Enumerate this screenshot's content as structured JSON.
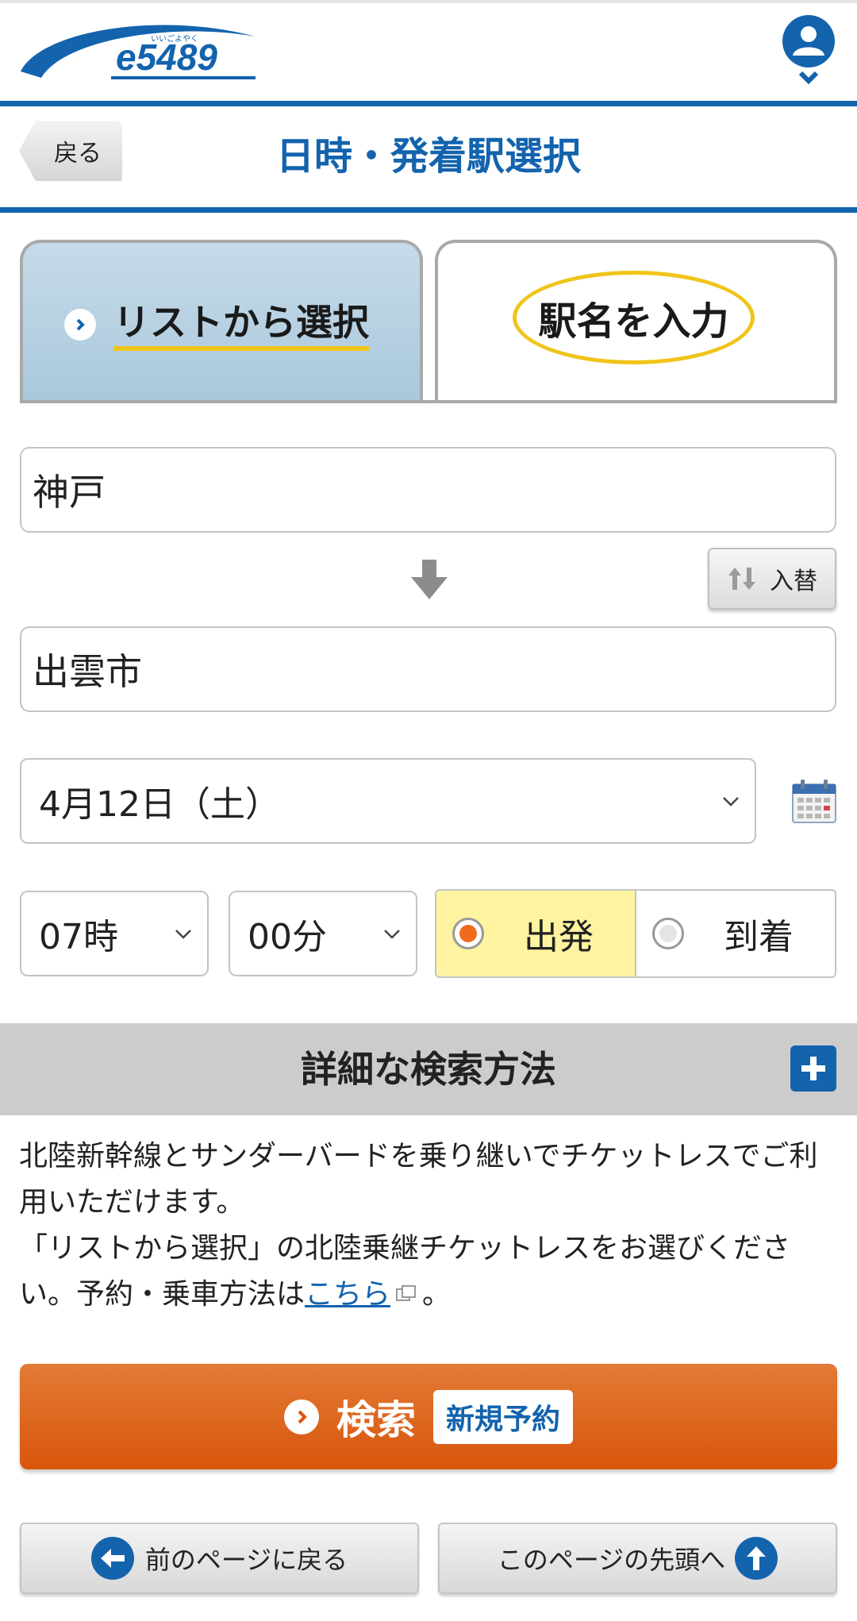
{
  "header": {
    "logo_text": "e5489",
    "logo_ruby": "いいごよやく",
    "account_icon": "person-icon"
  },
  "title_bar": {
    "back_label": "戻る",
    "title": "日時・発着駅選択"
  },
  "tabs": [
    {
      "label": "リストから選択",
      "icon": "chevron-right-icon"
    },
    {
      "label": "駅名を入力"
    }
  ],
  "form": {
    "from_station": "神戸",
    "swap_label": "入替",
    "to_station": "出雲市",
    "date": "4月12日（土）",
    "hour": "07時",
    "minute": "00分",
    "direction_options": [
      {
        "label": "出発",
        "selected": true
      },
      {
        "label": "到着",
        "selected": false
      }
    ]
  },
  "detail_search": {
    "label": "詳細な検索方法",
    "toggle_icon": "plus-icon"
  },
  "notice": {
    "line1": "北陸新幹線とサンダーバードを乗り継いでチケットレスでご利用いただけます。",
    "line2_pre": "「リストから選択」の北陸乗継チケットレスをお選びください。予約・乗車方法は",
    "link": "こちら",
    "line2_post": "。"
  },
  "search_button": {
    "label": "検索",
    "tag": "新規予約"
  },
  "footer": {
    "prev_label": "前のページに戻る",
    "top_label": "このページの先頭へ"
  },
  "colors": {
    "brand_blue": "#1363ad",
    "search_orange": "#d9560c",
    "highlight_yellow": "#f0c419",
    "selected_radio_bg": "#fdf3a0",
    "radio_selected_dot": "#f06a1e"
  }
}
